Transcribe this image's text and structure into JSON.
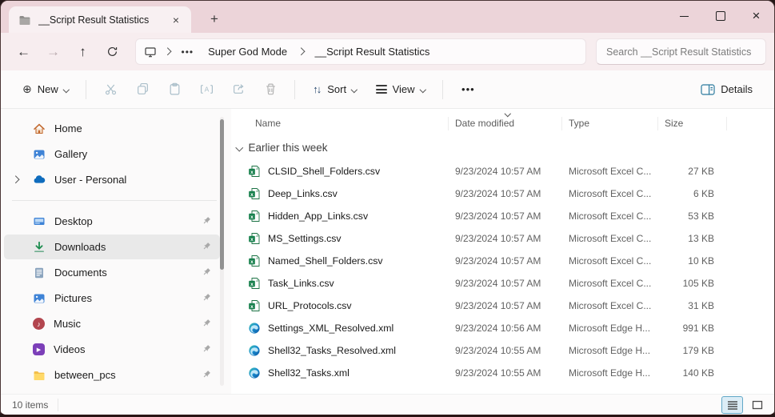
{
  "window": {
    "tab_title": "__Script Result Statistics",
    "tab_close_glyph": "×",
    "new_tab_glyph": "+",
    "controls": {
      "minimize": "minimize-line",
      "maximize": "square-outline",
      "close_glyph": "×"
    }
  },
  "navbar": {
    "back_glyph": "←",
    "forward_glyph": "→",
    "up_glyph": "↑",
    "refresh_icon": "refresh-arrow-svg",
    "breadcrumb": {
      "root_icon": "this-pc-monitor-svg",
      "ellipsis": "•••",
      "crumbs": [
        "Super God Mode",
        "__Script Result Statistics"
      ]
    },
    "search_placeholder": "Search __Script Result Statistics"
  },
  "toolbar": {
    "new_glyph": "⊕",
    "new_label": "New",
    "sort_glyph": "↑↓",
    "sort_label": "Sort",
    "view_label": "View",
    "more_glyph": "•••",
    "details_label": "Details",
    "disabled_icons": [
      "cut",
      "copy",
      "paste",
      "rename",
      "share",
      "delete"
    ]
  },
  "sidebar": {
    "top": [
      {
        "label": "Home",
        "icon": "home"
      },
      {
        "label": "Gallery",
        "icon": "gallery"
      },
      {
        "label": "User - Personal",
        "icon": "onedrive-cloud",
        "expandable": true
      }
    ],
    "pinned": [
      {
        "label": "Desktop",
        "icon": "desktop"
      },
      {
        "label": "Downloads",
        "icon": "download-arrow",
        "selected": true
      },
      {
        "label": "Documents",
        "icon": "document"
      },
      {
        "label": "Pictures",
        "icon": "pictures"
      },
      {
        "label": "Music",
        "icon": "music-note",
        "glyph": "♪"
      },
      {
        "label": "Videos",
        "icon": "play",
        "glyph": "▶"
      },
      {
        "label": "between_pcs",
        "icon": "folder"
      }
    ]
  },
  "files": {
    "columns": {
      "name": "Name",
      "date": "Date modified",
      "type": "Type",
      "size": "Size"
    },
    "group_label": "Earlier this week",
    "rows": [
      {
        "name": "CLSID_Shell_Folders.csv",
        "date": "9/23/2024 10:57 AM",
        "type": "Microsoft Excel C...",
        "size": "27 KB",
        "icon": "excel-csv"
      },
      {
        "name": "Deep_Links.csv",
        "date": "9/23/2024 10:57 AM",
        "type": "Microsoft Excel C...",
        "size": "6 KB",
        "icon": "excel-csv"
      },
      {
        "name": "Hidden_App_Links.csv",
        "date": "9/23/2024 10:57 AM",
        "type": "Microsoft Excel C...",
        "size": "53 KB",
        "icon": "excel-csv"
      },
      {
        "name": "MS_Settings.csv",
        "date": "9/23/2024 10:57 AM",
        "type": "Microsoft Excel C...",
        "size": "13 KB",
        "icon": "excel-csv"
      },
      {
        "name": "Named_Shell_Folders.csv",
        "date": "9/23/2024 10:57 AM",
        "type": "Microsoft Excel C...",
        "size": "10 KB",
        "icon": "excel-csv"
      },
      {
        "name": "Task_Links.csv",
        "date": "9/23/2024 10:57 AM",
        "type": "Microsoft Excel C...",
        "size": "105 KB",
        "icon": "excel-csv"
      },
      {
        "name": "URL_Protocols.csv",
        "date": "9/23/2024 10:57 AM",
        "type": "Microsoft Excel C...",
        "size": "31 KB",
        "icon": "excel-csv"
      },
      {
        "name": "Settings_XML_Resolved.xml",
        "date": "9/23/2024 10:56 AM",
        "type": "Microsoft Edge H...",
        "size": "991 KB",
        "icon": "edge-html"
      },
      {
        "name": "Shell32_Tasks_Resolved.xml",
        "date": "9/23/2024 10:55 AM",
        "type": "Microsoft Edge H...",
        "size": "179 KB",
        "icon": "edge-html"
      },
      {
        "name": "Shell32_Tasks.xml",
        "date": "9/23/2024 10:55 AM",
        "type": "Microsoft Edge H...",
        "size": "140 KB",
        "icon": "edge-html"
      }
    ]
  },
  "statusbar": {
    "count": "10 items"
  },
  "colors": {
    "titlebar_pink": "#ecd4d9",
    "tab_active": "#f8f0f2",
    "navbar_pink": "#f7edef",
    "excel_green": "#17804d",
    "edge_blue": "#0b59a8",
    "sidebar_selected": "#e9e9e9",
    "view_toggle_active_bg": "#dcedf6",
    "view_toggle_active_border": "#62a8c8"
  }
}
